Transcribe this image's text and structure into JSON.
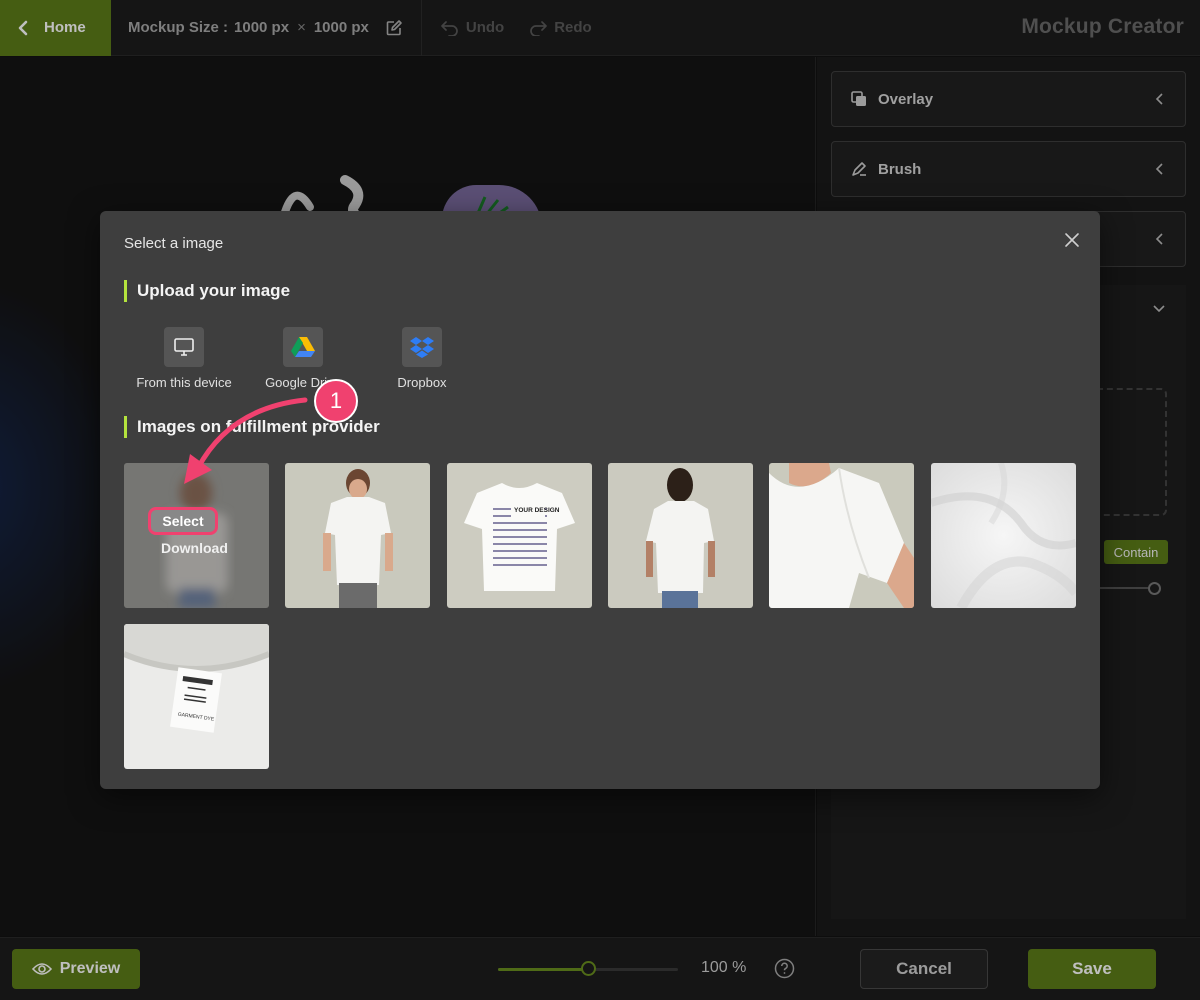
{
  "topbar": {
    "home_label": "Home",
    "mockup_size_label": "Mockup Size :",
    "width": "1000 px",
    "times": "×",
    "height": "1000 px",
    "undo_label": "Undo",
    "redo_label": "Redo",
    "app_title": "Mockup Creator"
  },
  "panel": {
    "accordions": [
      {
        "label": "Overlay",
        "icon": "overlay-icon"
      },
      {
        "label": "Brush",
        "icon": "brush-icon"
      },
      {
        "label": "",
        "icon": ""
      }
    ],
    "contain_label": "Contain"
  },
  "bottombar": {
    "preview_label": "Preview",
    "zoom_value": "100 %",
    "zoom_fraction": 0.5,
    "cancel_label": "Cancel",
    "save_label": "Save"
  },
  "modal": {
    "title": "Select a image",
    "upload_heading": "Upload your image",
    "sources": [
      {
        "label": "From this device",
        "icon": "monitor-icon"
      },
      {
        "label": "Google Drive",
        "icon": "google-drive-icon"
      },
      {
        "label": "Dropbox",
        "icon": "dropbox-icon"
      }
    ],
    "provider_heading": "Images on fulfillment provider",
    "select_label": "Select",
    "download_label": "Download",
    "thumbnails": [
      {
        "name": "blurred-model-front"
      },
      {
        "name": "man-white-tee-front"
      },
      {
        "name": "flat-tee-your-design"
      },
      {
        "name": "woman-white-tee-back"
      },
      {
        "name": "tee-shoulder-closeup"
      },
      {
        "name": "white-fabric-folds"
      },
      {
        "name": "neck-label-closeup"
      }
    ],
    "label_text": "GARMENT DYE",
    "flat_tee_text": "YOUR DESIGN"
  },
  "annotation": {
    "step_number": "1"
  },
  "colors": {
    "accent": "#5d7d19",
    "highlight": "#f0416f",
    "section_bar": "#b4e33d"
  }
}
